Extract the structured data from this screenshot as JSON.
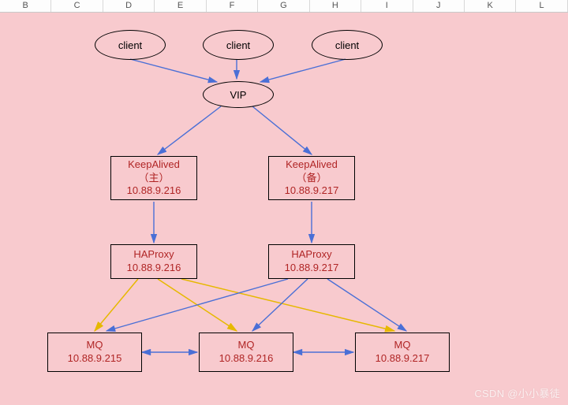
{
  "columns": [
    "B",
    "C",
    "D",
    "E",
    "F",
    "G",
    "H",
    "I",
    "J",
    "K",
    "L"
  ],
  "client1": "client",
  "client2": "client",
  "client3": "client",
  "vip": "VIP",
  "ka1": {
    "name": "KeepAlived",
    "role": "（主）",
    "ip": "10.88.9.216"
  },
  "ka2": {
    "name": "KeepAlived",
    "role": "（备）",
    "ip": "10.88.9.217"
  },
  "hp1": {
    "name": "HAProxy",
    "ip": "10.88.9.216"
  },
  "hp2": {
    "name": "HAProxy",
    "ip": "10.88.9.217"
  },
  "mq1": {
    "name": "MQ",
    "ip": "10.88.9.215"
  },
  "mq2": {
    "name": "MQ",
    "ip": "10.88.9.216"
  },
  "mq3": {
    "name": "MQ",
    "ip": "10.88.9.217"
  },
  "watermark": "CSDN @小小暴徒"
}
